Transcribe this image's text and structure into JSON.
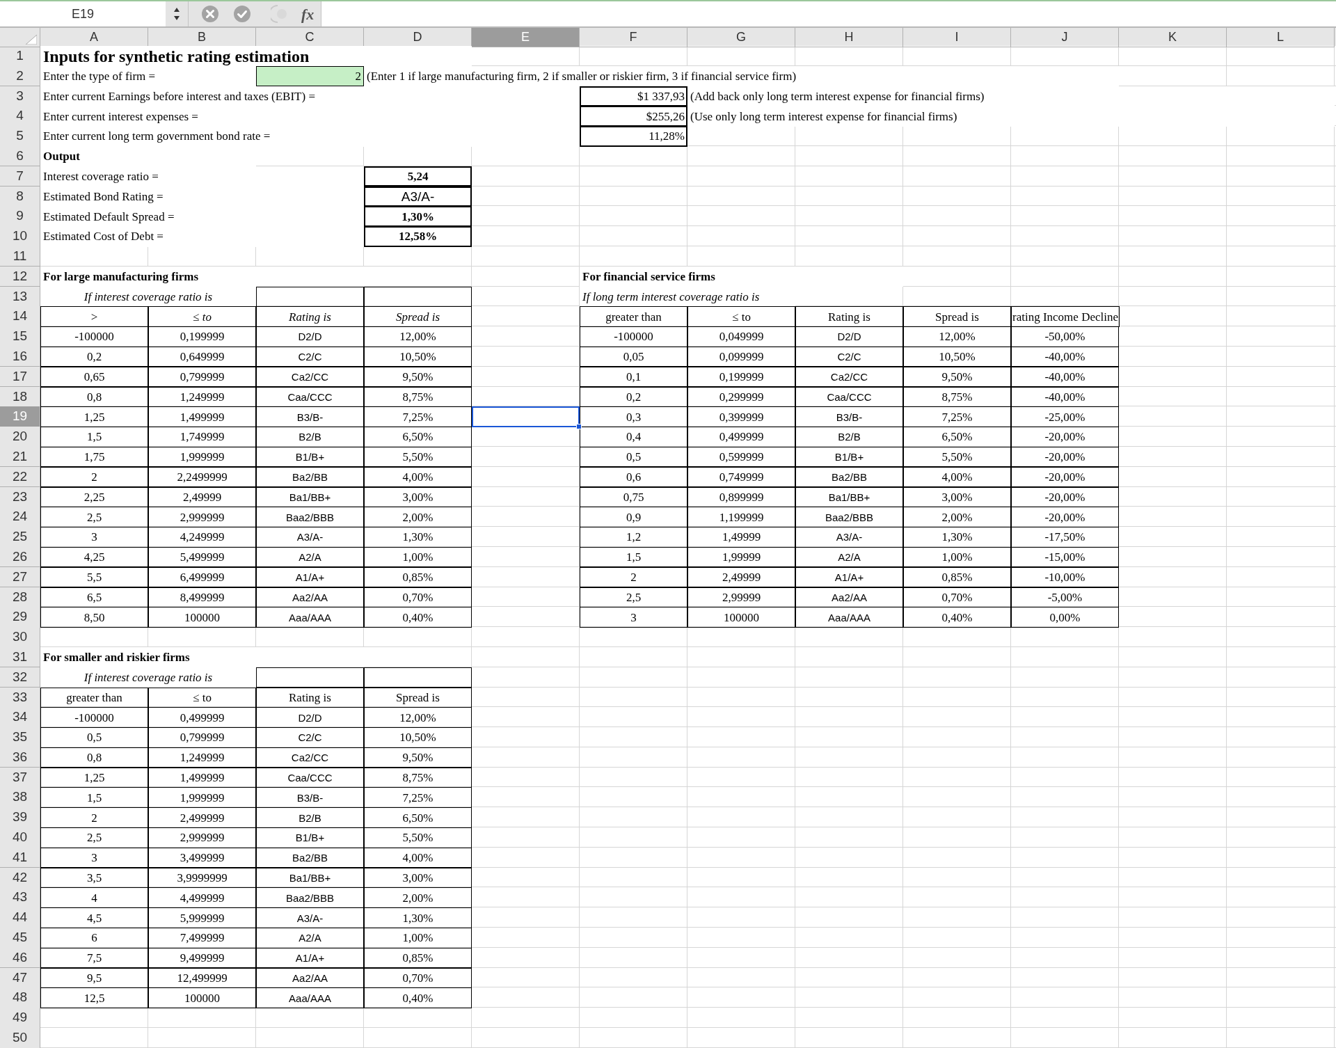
{
  "formula_bar": {
    "cell_reference": "E19",
    "function_label": "fx"
  },
  "columns": [
    {
      "label": "A",
      "selected": false
    },
    {
      "label": "B",
      "selected": false
    },
    {
      "label": "C",
      "selected": false
    },
    {
      "label": "D",
      "selected": false
    },
    {
      "label": "E",
      "selected": true
    },
    {
      "label": "F",
      "selected": false
    },
    {
      "label": "G",
      "selected": false
    },
    {
      "label": "H",
      "selected": false
    },
    {
      "label": "I",
      "selected": false
    },
    {
      "label": "J",
      "selected": false
    },
    {
      "label": "K",
      "selected": false
    },
    {
      "label": "L",
      "selected": false
    }
  ],
  "rows": [
    {
      "label": "1",
      "selected": false
    },
    {
      "label": "2",
      "selected": false
    },
    {
      "label": "3",
      "selected": false
    },
    {
      "label": "4",
      "selected": false
    },
    {
      "label": "5",
      "selected": false
    },
    {
      "label": "6",
      "selected": false
    },
    {
      "label": "7",
      "selected": false
    },
    {
      "label": "8",
      "selected": false
    },
    {
      "label": "9",
      "selected": false
    },
    {
      "label": "10",
      "selected": false
    },
    {
      "label": "11",
      "selected": false
    },
    {
      "label": "12",
      "selected": false
    },
    {
      "label": "13",
      "selected": false
    },
    {
      "label": "14",
      "selected": false
    },
    {
      "label": "15",
      "selected": false
    },
    {
      "label": "16",
      "selected": false
    },
    {
      "label": "17",
      "selected": false
    },
    {
      "label": "18",
      "selected": false
    },
    {
      "label": "19",
      "selected": true
    },
    {
      "label": "20",
      "selected": false
    },
    {
      "label": "21",
      "selected": false
    },
    {
      "label": "22",
      "selected": false
    },
    {
      "label": "23",
      "selected": false
    },
    {
      "label": "24",
      "selected": false
    },
    {
      "label": "25",
      "selected": false
    },
    {
      "label": "26",
      "selected": false
    },
    {
      "label": "27",
      "selected": false
    },
    {
      "label": "28",
      "selected": false
    },
    {
      "label": "29",
      "selected": false
    },
    {
      "label": "30",
      "selected": false
    },
    {
      "label": "31",
      "selected": false
    },
    {
      "label": "32",
      "selected": false
    },
    {
      "label": "33",
      "selected": false
    },
    {
      "label": "34",
      "selected": false
    },
    {
      "label": "35",
      "selected": false
    },
    {
      "label": "36",
      "selected": false
    },
    {
      "label": "37",
      "selected": false
    },
    {
      "label": "38",
      "selected": false
    },
    {
      "label": "39",
      "selected": false
    },
    {
      "label": "40",
      "selected": false
    },
    {
      "label": "41",
      "selected": false
    },
    {
      "label": "42",
      "selected": false
    },
    {
      "label": "43",
      "selected": false
    },
    {
      "label": "44",
      "selected": false
    },
    {
      "label": "45",
      "selected": false
    },
    {
      "label": "46",
      "selected": false
    },
    {
      "label": "47",
      "selected": false
    },
    {
      "label": "48",
      "selected": false
    },
    {
      "label": "49",
      "selected": false
    },
    {
      "label": "50",
      "selected": false
    }
  ],
  "title": "Inputs for synthetic rating estimation",
  "inputs": [
    {
      "kind": "selector",
      "label": "Enter the type of firm =",
      "value": "2",
      "note": "(Enter 1 if large manufacturing firm, 2 if smaller or riskier firm, 3 if financial service firm)"
    },
    {
      "kind": "amount",
      "label": "Enter current Earnings before interest and taxes (EBIT) =",
      "value": "$1 337,93",
      "note": "(Add back only long term interest expense for financial firms)"
    },
    {
      "kind": "amount",
      "label": "Enter current interest expenses =",
      "value": "$255,26",
      "note": "(Use only long term interest expense for financial firms)"
    },
    {
      "kind": "amount",
      "label": "Enter current long term government bond rate =",
      "value": "11,28%"
    }
  ],
  "output_heading": "Output",
  "outputs": [
    {
      "kind": "number",
      "label": "Interest  coverage ratio =",
      "value": "5,24"
    },
    {
      "kind": "rating",
      "label": "Estimated Bond Rating =",
      "value": "A3/A-"
    },
    {
      "kind": "number",
      "label": "Estimated Default Spread =",
      "value": "1,30%"
    },
    {
      "kind": "number",
      "label": "Estimated Cost of Debt =",
      "value": "12,58%"
    }
  ],
  "large_firms_table": {
    "title": "For large manufacturing firms",
    "subtitle": "If interest coverage ratio is",
    "columns": [
      ">",
      "≤ to",
      "Rating is",
      "Spread is"
    ],
    "rows": [
      [
        "-100000",
        "0,199999",
        "D2/D",
        "12,00%"
      ],
      [
        "0,2",
        "0,649999",
        "C2/C",
        "10,50%"
      ],
      [
        "0,65",
        "0,799999",
        "Ca2/CC",
        "9,50%"
      ],
      [
        "0,8",
        "1,249999",
        "Caa/CCC",
        "8,75%"
      ],
      [
        "1,25",
        "1,499999",
        "B3/B-",
        "7,25%"
      ],
      [
        "1,5",
        "1,749999",
        "B2/B",
        "6,50%"
      ],
      [
        "1,75",
        "1,999999",
        "B1/B+",
        "5,50%"
      ],
      [
        "2",
        "2,2499999",
        "Ba2/BB",
        "4,00%"
      ],
      [
        "2,25",
        "2,49999",
        "Ba1/BB+",
        "3,00%"
      ],
      [
        "2,5",
        "2,999999",
        "Baa2/BBB",
        "2,00%"
      ],
      [
        "3",
        "4,249999",
        "A3/A-",
        "1,30%"
      ],
      [
        "4,25",
        "5,499999",
        "A2/A",
        "1,00%"
      ],
      [
        "5,5",
        "6,499999",
        "A1/A+",
        "0,85%"
      ],
      [
        "6,5",
        "8,499999",
        "Aa2/AA",
        "0,70%"
      ],
      [
        "8,50",
        "100000",
        "Aaa/AAA",
        "0,40%"
      ]
    ]
  },
  "financial_firms_table": {
    "title": "For financial service firms",
    "subtitle": "If long term interest coverage ratio is",
    "columns": [
      "greater than",
      "≤ to",
      "Rating is",
      "Spread is",
      "rating Income Decline"
    ],
    "rows": [
      [
        "-100000",
        "0,049999",
        "D2/D",
        "12,00%",
        "-50,00%"
      ],
      [
        "0,05",
        "0,099999",
        "C2/C",
        "10,50%",
        "-40,00%"
      ],
      [
        "0,1",
        "0,199999",
        "Ca2/CC",
        "9,50%",
        "-40,00%"
      ],
      [
        "0,2",
        "0,299999",
        "Caa/CCC",
        "8,75%",
        "-40,00%"
      ],
      [
        "0,3",
        "0,399999",
        "B3/B-",
        "7,25%",
        "-25,00%"
      ],
      [
        "0,4",
        "0,499999",
        "B2/B",
        "6,50%",
        "-20,00%"
      ],
      [
        "0,5",
        "0,599999",
        "B1/B+",
        "5,50%",
        "-20,00%"
      ],
      [
        "0,6",
        "0,749999",
        "Ba2/BB",
        "4,00%",
        "-20,00%"
      ],
      [
        "0,75",
        "0,899999",
        "Ba1/BB+",
        "3,00%",
        "-20,00%"
      ],
      [
        "0,9",
        "1,199999",
        "Baa2/BBB",
        "2,00%",
        "-20,00%"
      ],
      [
        "1,2",
        "1,49999",
        "A3/A-",
        "1,30%",
        "-17,50%"
      ],
      [
        "1,5",
        "1,99999",
        "A2/A",
        "1,00%",
        "-15,00%"
      ],
      [
        "2",
        "2,49999",
        "A1/A+",
        "0,85%",
        "-10,00%"
      ],
      [
        "2,5",
        "2,99999",
        "Aa2/AA",
        "0,70%",
        "-5,00%"
      ],
      [
        "3",
        "100000",
        "Aaa/AAA",
        "0,40%",
        "0,00%"
      ]
    ]
  },
  "small_firms_table": {
    "title": "For smaller and riskier firms",
    "subtitle": "If interest coverage ratio is",
    "columns": [
      "greater than",
      "≤ to",
      "Rating is",
      "Spread is"
    ],
    "rows": [
      [
        "-100000",
        "0,499999",
        "D2/D",
        "12,00%"
      ],
      [
        "0,5",
        "0,799999",
        "C2/C",
        "10,50%"
      ],
      [
        "0,8",
        "1,249999",
        "Ca2/CC",
        "9,50%"
      ],
      [
        "1,25",
        "1,499999",
        "Caa/CCC",
        "8,75%"
      ],
      [
        "1,5",
        "1,999999",
        "B3/B-",
        "7,25%"
      ],
      [
        "2",
        "2,499999",
        "B2/B",
        "6,50%"
      ],
      [
        "2,5",
        "2,999999",
        "B1/B+",
        "5,50%"
      ],
      [
        "3",
        "3,499999",
        "Ba2/BB",
        "4,00%"
      ],
      [
        "3,5",
        "3,9999999",
        "Ba1/BB+",
        "3,00%"
      ],
      [
        "4",
        "4,499999",
        "Baa2/BBB",
        "2,00%"
      ],
      [
        "4,5",
        "5,999999",
        "A3/A-",
        "1,30%"
      ],
      [
        "6",
        "7,499999",
        "A2/A",
        "1,00%"
      ],
      [
        "7,5",
        "9,499999",
        "A1/A+",
        "0,85%"
      ],
      [
        "9,5",
        "12,499999",
        "Aa2/AA",
        "0,70%"
      ],
      [
        "12,5",
        "100000",
        "Aaa/AAA",
        "0,40%"
      ]
    ]
  }
}
